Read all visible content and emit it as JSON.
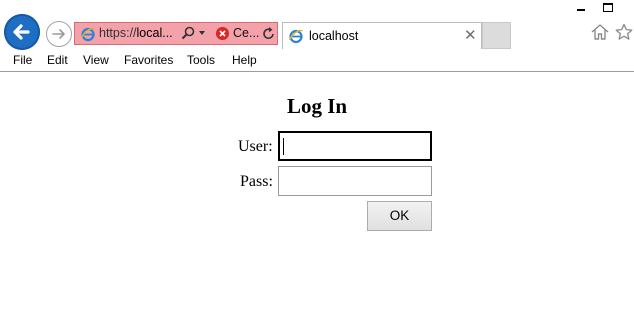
{
  "window": {
    "minimize_glyph": "minimize-icon",
    "maximize_glyph": "maximize-icon"
  },
  "browser": {
    "address": {
      "url_prefix": "https://",
      "url_host": "local...",
      "cert_text": "Ce..."
    },
    "tab": {
      "title": "localhost"
    }
  },
  "menu": {
    "items": [
      "File",
      "Edit",
      "View",
      "Favorites",
      "Tools",
      "Help"
    ]
  },
  "login": {
    "title": "Log In",
    "user_label": "User:",
    "user_value": "",
    "pass_label": "Pass:",
    "pass_value": "",
    "ok_label": "OK"
  },
  "colors": {
    "back_button": "#1e6fc4",
    "address_bar_error": "#f4a2a9",
    "cert_error": "#d42a2a"
  }
}
